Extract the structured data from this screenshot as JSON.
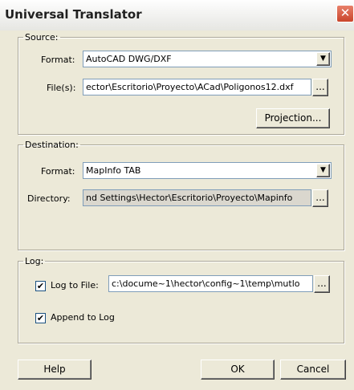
{
  "window": {
    "title": "Universal Translator",
    "close_glyph": "✕"
  },
  "source": {
    "legend": "Source:",
    "format_label": "Format:",
    "format_value": "AutoCAD DWG/DXF",
    "files_label": "File(s):",
    "files_value": "ector\\Escritorio\\Proyecto\\ACad\\Poligonos12.dxf",
    "browse_label": "...",
    "projection_label": "Projection..."
  },
  "destination": {
    "legend": "Destination:",
    "format_label": "Format:",
    "format_value": "MapInfo TAB",
    "directory_label": "Directory:",
    "directory_value": "nd Settings\\Hector\\Escritorio\\Proyecto\\Mapinfo",
    "browse_label": "..."
  },
  "log": {
    "legend": "Log:",
    "log_to_file_label": "Log to File:",
    "log_to_file_checked": true,
    "log_path": "c:\\docume~1\\hector\\config~1\\temp\\mutlo",
    "browse_label": "...",
    "append_label": "Append to Log",
    "append_checked": true,
    "check_glyph": "✔"
  },
  "buttons": {
    "help": "Help",
    "ok": "OK",
    "cancel": "Cancel"
  },
  "icons": {
    "dropdown": "▼"
  }
}
